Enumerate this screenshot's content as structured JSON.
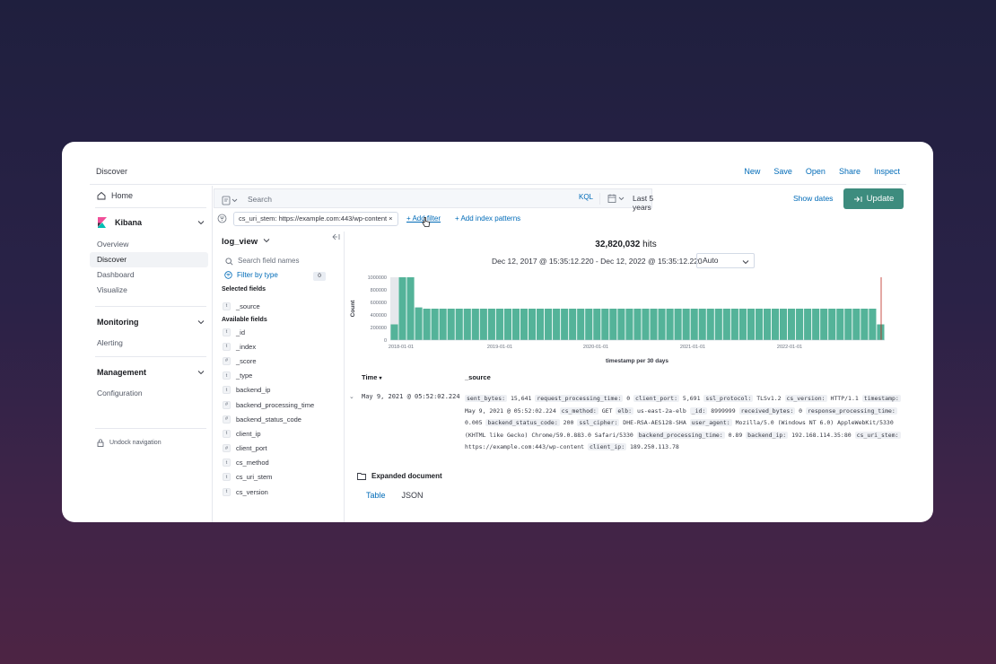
{
  "app": {
    "title": "Discover"
  },
  "top_actions": [
    "New",
    "Save",
    "Open",
    "Share",
    "Inspect"
  ],
  "nav": {
    "home": "Home",
    "kibana_group": {
      "label": "Kibana",
      "items": [
        "Overview",
        "Discover",
        "Dashboard",
        "Visualize"
      ],
      "active": "Discover"
    },
    "monitoring_group": {
      "label": "Monitoring",
      "items": [
        "Alerting"
      ]
    },
    "management_group": {
      "label": "Management",
      "items": [
        "Configuration"
      ]
    },
    "undock": "Undock navigation"
  },
  "search": {
    "placeholder": "Search",
    "language": "KQL",
    "time_range": "Last 5 years",
    "show_dates": "Show dates",
    "update_label": "Update"
  },
  "filters": {
    "pill": "cs_uri_stem: https://example.com:443/wp-content",
    "add_filter": "+ Add filter",
    "add_index": "+ Add index patterns"
  },
  "fields_panel": {
    "index_pattern": "log_view",
    "search_placeholder": "Search field names",
    "filter_by_type": "Filter by type",
    "filter_count": "0",
    "selected_title": "Selected fields",
    "selected": [
      {
        "type": "t",
        "name": "_source"
      }
    ],
    "available_title": "Available fields",
    "available": [
      {
        "type": "t",
        "name": "_id"
      },
      {
        "type": "t",
        "name": "_index"
      },
      {
        "type": "#",
        "name": "_score"
      },
      {
        "type": "t",
        "name": "_type"
      },
      {
        "type": "t",
        "name": "backend_ip"
      },
      {
        "type": "#",
        "name": "backend_processing_time"
      },
      {
        "type": "#",
        "name": "backend_status_code"
      },
      {
        "type": "t",
        "name": "client_ip"
      },
      {
        "type": "#",
        "name": "client_port"
      },
      {
        "type": "t",
        "name": "cs_method"
      },
      {
        "type": "t",
        "name": "cs_uri_stem"
      },
      {
        "type": "t",
        "name": "cs_version"
      }
    ]
  },
  "results": {
    "hits_count": "32,820,032",
    "hits_label": "hits",
    "range": "Dec 12, 2017 @ 15:35:12.220 - Dec 12, 2022 @ 15:35:12.220",
    "interval": "Auto",
    "col_time": "Time",
    "col_source": "_source",
    "row_time": "May 9, 2021 @ 05:52:02.224",
    "expanded_title": "Expanded document",
    "tab_table": "Table",
    "tab_json": "JSON",
    "source_pairs": [
      [
        "sent_bytes:",
        "15,641"
      ],
      [
        "request_processing_time:",
        "0"
      ],
      [
        "client_port:",
        "5,691"
      ],
      [
        "ssl_protocol:",
        "TLSv1.2"
      ],
      [
        "cs_version:",
        "HTTP/1.1"
      ],
      [
        "timestamp:",
        "May 9, 2021 @ 05:52:02.224"
      ],
      [
        "cs_method:",
        "GET"
      ],
      [
        "elb:",
        "us-east-2a-elb"
      ],
      [
        "_id:",
        "8999999"
      ],
      [
        "received_bytes:",
        "0"
      ],
      [
        "response_processing_time:",
        "0.005"
      ],
      [
        "backend_status_code:",
        "200"
      ],
      [
        "ssl_cipher:",
        "DHE-RSA-AES128-SHA"
      ],
      [
        "user_agent:",
        "Mozilla/5.0 (Windows NT 6.0) AppleWebKit/5330 (KHTML like Gecko) Chrome/59.0.883.0 Safari/5330"
      ],
      [
        "backend_processing_time:",
        "0.89"
      ],
      [
        "backend_ip:",
        "192.168.114.35:80"
      ],
      [
        "cs_uri_stem:",
        "https://example.com:443/wp-content"
      ],
      [
        "client_ip:",
        "189.250.113.78"
      ]
    ]
  },
  "chart_data": {
    "type": "bar",
    "title": "",
    "xlabel": "timestamp per 30 days",
    "ylabel": "Count",
    "ylim": [
      0,
      1000000
    ],
    "yticks": [
      0,
      200000,
      400000,
      600000,
      800000,
      1000000
    ],
    "ytick_labels": [
      "0",
      "200000",
      "400000",
      "600000",
      "800000",
      "1000000"
    ],
    "xticks": [
      "2018-01-01",
      "2019-01-01",
      "2020-01-01",
      "2021-01-01",
      "2022-01-01"
    ],
    "color": "#54b399",
    "values": [
      250000,
      1000000,
      1000000,
      520000,
      500000,
      500000,
      500000,
      500000,
      500000,
      500000,
      500000,
      500000,
      500000,
      500000,
      500000,
      500000,
      500000,
      500000,
      500000,
      500000,
      500000,
      500000,
      500000,
      500000,
      500000,
      500000,
      500000,
      500000,
      500000,
      500000,
      500000,
      500000,
      500000,
      500000,
      500000,
      500000,
      500000,
      500000,
      500000,
      500000,
      500000,
      500000,
      500000,
      500000,
      500000,
      500000,
      500000,
      500000,
      500000,
      500000,
      500000,
      500000,
      500000,
      500000,
      500000,
      500000,
      500000,
      500000,
      500000,
      500000,
      250000
    ]
  }
}
